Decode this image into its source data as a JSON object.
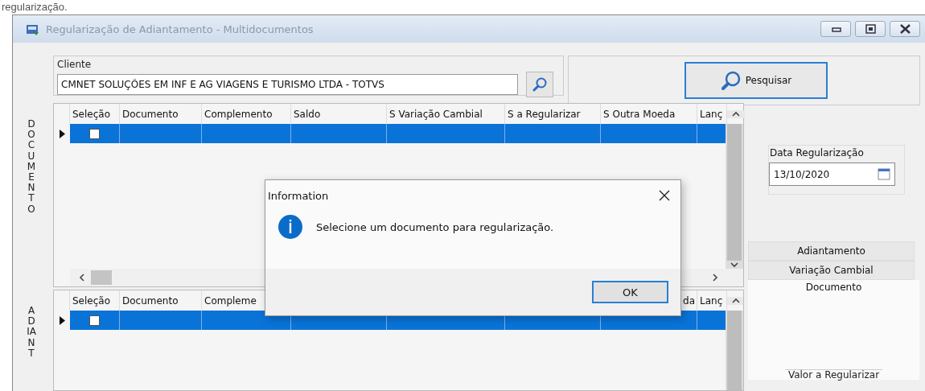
{
  "page_text": "regularização.",
  "window": {
    "title": "Regularização de Adiantamento - Multidocumentos"
  },
  "cliente": {
    "label": "Cliente",
    "value": "CMNET SOLUÇÕES EM INF E AG VIAGENS E TURISMO LTDA - TOTVS"
  },
  "search_button": {
    "label": "Pesquisar"
  },
  "grids": [
    {
      "side_label": "DOCUMENTO",
      "columns": [
        {
          "label": "Seleção"
        },
        {
          "label": "Documento"
        },
        {
          "label": "Complemento"
        },
        {
          "label": "Saldo"
        },
        {
          "label": "S Variação Cambial"
        },
        {
          "label": "S a Regularizar"
        },
        {
          "label": "S Outra Moeda"
        },
        {
          "label": "Lanç"
        }
      ],
      "rows": [
        {
          "selected": true,
          "checked": false
        }
      ],
      "hscroll": true
    },
    {
      "side_label": "ADIANT",
      "columns": [
        {
          "label": "Seleção"
        },
        {
          "label": "Documento"
        },
        {
          "label": "Compleme"
        },
        {},
        {},
        {},
        {
          "label": "da",
          "right_aligned": true
        },
        {
          "label": "Lanç"
        }
      ],
      "rows": [
        {
          "selected": true,
          "checked": false
        }
      ],
      "hscroll": false
    }
  ],
  "date_field": {
    "label": "Data Regularização",
    "value": "13/10/2020"
  },
  "tabs": [
    {
      "label": "Adiantamento",
      "selected": false
    },
    {
      "label": "Variação Cambial",
      "selected": false
    },
    {
      "label": "Documento",
      "selected": true
    }
  ],
  "group_label": "Valor a Regularizar",
  "dialog": {
    "title": "Information",
    "message": "Selecione um documento para regularização.",
    "button": "OK"
  }
}
